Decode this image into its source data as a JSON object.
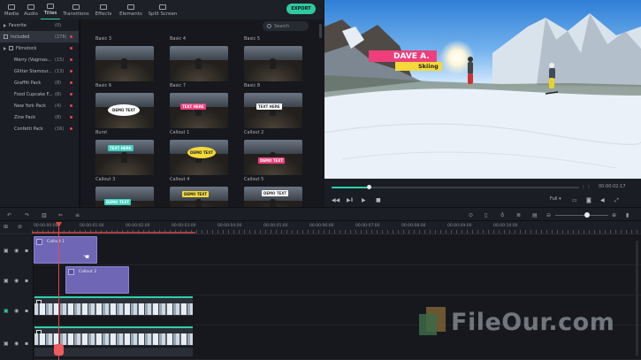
{
  "nav": {
    "tabs": [
      {
        "label": "Media",
        "icon": "media-icon"
      },
      {
        "label": "Audio",
        "icon": "audio-icon"
      },
      {
        "label": "Titles",
        "icon": "titles-icon",
        "active": true
      },
      {
        "label": "Transitions",
        "icon": "transitions-icon"
      },
      {
        "label": "Effects",
        "icon": "effects-icon"
      },
      {
        "label": "Elements",
        "icon": "elements-icon"
      },
      {
        "label": "Split Screen",
        "icon": "split-screen-icon"
      }
    ],
    "export_label": "EXPORT"
  },
  "sidebar": {
    "items": [
      {
        "label": "Favorite",
        "count": "(0)"
      },
      {
        "label": "Included",
        "count": "(276)"
      },
      {
        "label": "Filmstock",
        "count": ""
      },
      {
        "label": "Merry (Vogmas...",
        "count": "(15)"
      },
      {
        "label": "Glitter Stamour...",
        "count": "(13)"
      },
      {
        "label": "Graffiti Pack",
        "count": "(8)"
      },
      {
        "label": "Food Cupcake F...",
        "count": "(8)"
      },
      {
        "label": "New York Pack",
        "count": "(4)"
      },
      {
        "label": "Zine Pack",
        "count": "(8)"
      },
      {
        "label": "Confetti Pack",
        "count": "(16)"
      }
    ]
  },
  "search": {
    "placeholder": "Search"
  },
  "grid": {
    "row_labels": [
      [
        "Basic 3",
        "Basic 4",
        "Basic 5"
      ],
      [
        "Basic 6",
        "Basic 7",
        "Basic 8"
      ],
      [
        "Burst",
        "Callout 1",
        "Callout 2"
      ],
      [
        "Callout 3",
        "Callout 4",
        "Callout 5"
      ]
    ],
    "captions": {
      "demo_text": "DEMO TEXT",
      "text_here": "TEXT HERE",
      "demo_text_small": "DEMO TEXT"
    }
  },
  "preview": {
    "name": "DAVE A.",
    "sport": "Skiing"
  },
  "player": {
    "progress": 0.15,
    "timecode": "00:00:02:17",
    "quality": "Full"
  },
  "ruler": {
    "labels": [
      "00:00:00:00",
      "00:00:01:00",
      "00:00:02:00",
      "00:00:03:00",
      "00:00:04:00",
      "00:00:05:00",
      "00:00:06:00",
      "00:00:07:00",
      "00:00:08:00",
      "00:00:09:00",
      "00:00:10:00"
    ]
  },
  "timeline": {
    "clips": {
      "title1": "Callout 1",
      "title2": "Callout 2"
    }
  },
  "watermark": {
    "text": "FileOur.com"
  }
}
